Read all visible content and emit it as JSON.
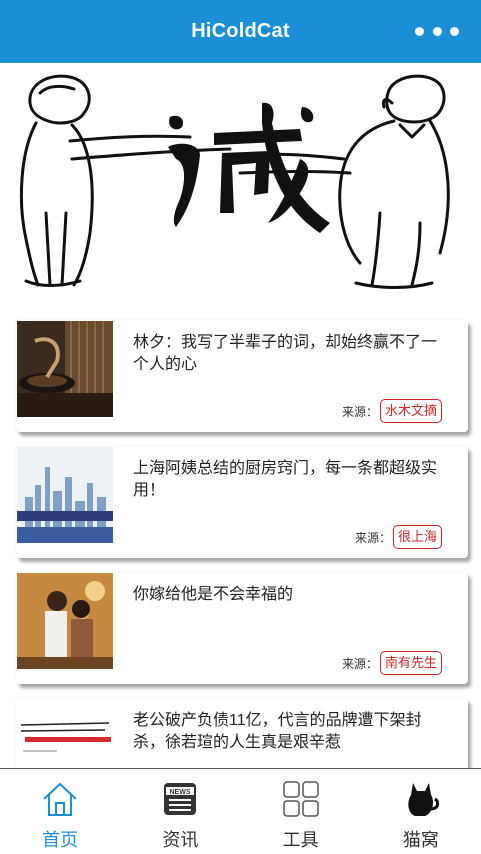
{
  "header": {
    "title": "HiColdCat",
    "more_icon": "more-dots-icon"
  },
  "banner": {
    "image": "two-men-shaking-hands-with-calligraphy",
    "calligraphy": "诚",
    "slide_count": 5,
    "active_index": 3
  },
  "feed": {
    "source_prefix": "来源：",
    "items": [
      {
        "title": "林夕：我写了半辈子的词，却始终赢不了一个人的心",
        "source": "水木文摘",
        "thumbnail": "vintage-record-player"
      },
      {
        "title": "上海阿姨总结的厨房窍门，每一条都超级实用！",
        "source": "很上海",
        "thumbnail": "shanghai-skyline"
      },
      {
        "title": "你嫁给他是不会幸福的",
        "source": "南有先生",
        "thumbnail": "couple-photo"
      },
      {
        "title": "老公破产负债11亿，代言的品牌遭下架封杀，徐若瑄的人生真是艰辛惹",
        "source": "",
        "thumbnail": "news-headline-image"
      }
    ]
  },
  "tabbar": {
    "active": "home",
    "tabs": [
      {
        "id": "home",
        "label": "首页",
        "icon": "home-icon"
      },
      {
        "id": "news",
        "label": "资讯",
        "icon": "news-icon"
      },
      {
        "id": "tools",
        "label": "工具",
        "icon": "grid-icon"
      },
      {
        "id": "cat",
        "label": "猫窝",
        "icon": "cat-icon"
      }
    ]
  },
  "colors": {
    "accent": "#1a8fd6",
    "tag_red": "#d02828"
  }
}
